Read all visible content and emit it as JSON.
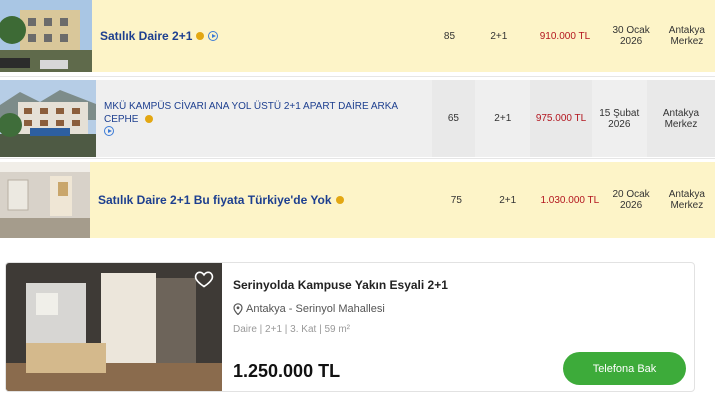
{
  "listings": [
    {
      "title": "Satılık Daire 2+1",
      "size": "85",
      "rooms": "2+1",
      "price": "910.000 TL",
      "date_day": "30 Ocak",
      "date_year": "2026",
      "loc_city": "Antakya",
      "loc_area": "Merkez"
    },
    {
      "title": "MKÜ KAMPÜS CİVARI ANA YOL ÜSTÜ 2+1 APART DAİRE ARKA CEPHE",
      "size": "65",
      "rooms": "2+1",
      "price": "975.000 TL",
      "date_day": "15 Şubat",
      "date_year": "2026",
      "loc_city": "Antakya",
      "loc_area": "Merkez"
    },
    {
      "title": "Satılık Daire 2+1 Bu fiyata Türkiye'de Yok",
      "size": "75",
      "rooms": "2+1",
      "price": "1.030.000 TL",
      "date_day": "20 Ocak",
      "date_year": "2026",
      "loc_city": "Antakya",
      "loc_area": "Merkez"
    }
  ],
  "card": {
    "title": "Serinyolda Kampuse Yakın Esyali 2+1",
    "location": "Antakya - Serinyol Mahallesi",
    "details": "Daire | 2+1 | 3. Kat | 59 m²",
    "price": "1.250.000 TL",
    "button": "Telefona Bak"
  },
  "colors": {
    "highlight_row": "#fdf4c8",
    "title_blue": "#1d3f8f",
    "price_red": "#b3161f",
    "button_green": "#3dab3a"
  }
}
